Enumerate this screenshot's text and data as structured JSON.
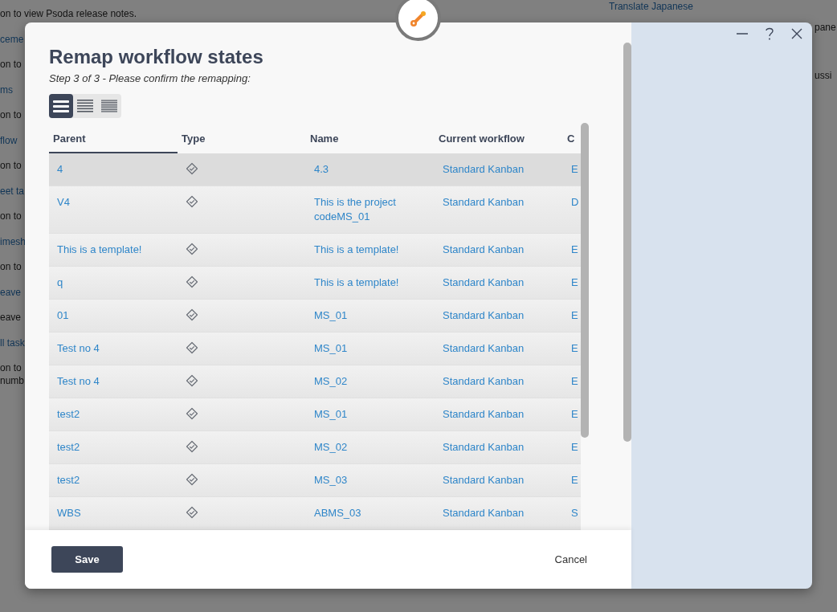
{
  "background": {
    "left": [
      {
        "text": "on to view Psoda release notes.",
        "kind": "text"
      },
      {
        "text": "ceme",
        "kind": "link"
      },
      {
        "text": "on to",
        "kind": "text"
      },
      {
        "text": "ms",
        "kind": "link"
      },
      {
        "text": "on to",
        "kind": "text"
      },
      {
        "text": "flow",
        "kind": "link"
      },
      {
        "text": "on to",
        "kind": "text"
      },
      {
        "text": "eet ta",
        "kind": "link"
      },
      {
        "text": "on to",
        "kind": "text"
      },
      {
        "text": "imesh",
        "kind": "link"
      },
      {
        "text": "on to",
        "kind": "text"
      },
      {
        "text": "eave",
        "kind": "link"
      },
      {
        "text": "eave",
        "kind": "text"
      },
      {
        "text": "ll task",
        "kind": "link"
      },
      {
        "text": "on to",
        "kind": "text"
      },
      {
        "text": "numb",
        "kind": "text"
      }
    ],
    "right": [
      {
        "text": "Translate Japanese",
        "kind": "link"
      },
      {
        "text": "pane",
        "kind": "text"
      },
      {
        "text": "ussi",
        "kind": "text"
      }
    ]
  },
  "dialog": {
    "title": "Remap workflow states",
    "subtitle": "Step 3 of 3 - Please confirm the remapping:",
    "window_controls": [
      {
        "kind": "minimize"
      },
      {
        "kind": "help"
      },
      {
        "kind": "close"
      }
    ],
    "view_modes": [
      {
        "kind": "comfortable",
        "selected": true
      },
      {
        "kind": "compact",
        "selected": false
      },
      {
        "kind": "dense",
        "selected": false
      }
    ],
    "table": {
      "columns": [
        {
          "label": "Parent",
          "sorted": true
        },
        {
          "label": "Type",
          "sorted": false
        },
        {
          "label": "Name",
          "sorted": false
        },
        {
          "label": "Current workflow",
          "sorted": false
        },
        {
          "label": "C",
          "sorted": false
        }
      ],
      "rows": [
        {
          "parent": "4",
          "name": "4.3",
          "workflow": "Standard Kanban",
          "column_5": "E",
          "selected": true
        },
        {
          "parent": "V4",
          "name": "This is the project codeMS_01",
          "workflow": "Standard Kanban",
          "column_5": "D",
          "selected": false
        },
        {
          "parent": "This is a template!",
          "name": "This is a template!",
          "workflow": "Standard Kanban",
          "column_5": "E",
          "selected": false
        },
        {
          "parent": "q",
          "name": "This is a template!",
          "workflow": "Standard Kanban",
          "column_5": "E",
          "selected": false
        },
        {
          "parent": "01",
          "name": "MS_01",
          "workflow": "Standard Kanban",
          "column_5": "E",
          "selected": false
        },
        {
          "parent": "Test no 4",
          "name": "MS_01",
          "workflow": "Standard Kanban",
          "column_5": "E",
          "selected": false
        },
        {
          "parent": "Test no 4",
          "name": "MS_02",
          "workflow": "Standard Kanban",
          "column_5": "E",
          "selected": false
        },
        {
          "parent": "test2",
          "name": "MS_01",
          "workflow": "Standard Kanban",
          "column_5": "E",
          "selected": false
        },
        {
          "parent": "test2",
          "name": "MS_02",
          "workflow": "Standard Kanban",
          "column_5": "E",
          "selected": false
        },
        {
          "parent": "test2",
          "name": "MS_03",
          "workflow": "Standard Kanban",
          "column_5": "E",
          "selected": false
        },
        {
          "parent": "WBS",
          "name": "ABMS_03",
          "workflow": "Standard Kanban",
          "column_5": "S",
          "selected": false
        }
      ]
    },
    "buttons": {
      "save": "Save",
      "cancel": "Cancel"
    }
  }
}
